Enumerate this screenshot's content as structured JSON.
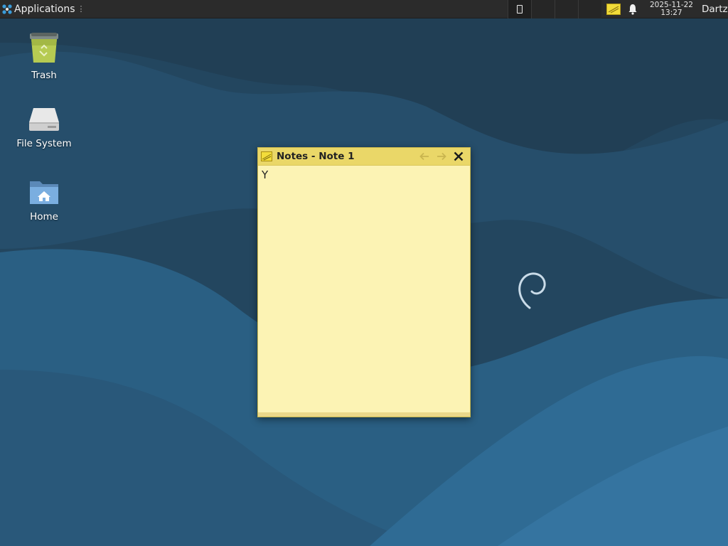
{
  "panel": {
    "apps_label": "Applications",
    "apps_grip": "⋮",
    "clock_date": "2025-11-22",
    "clock_time": "13:27",
    "user": "Dartz"
  },
  "desktop": {
    "icons": [
      {
        "label": "Trash",
        "icon": "trash-icon"
      },
      {
        "label": "File System",
        "icon": "drive-icon"
      },
      {
        "label": "Home",
        "icon": "home-folder-icon"
      }
    ]
  },
  "note": {
    "title": "Notes - Note 1",
    "content": "Y"
  },
  "colors": {
    "panel": "#2b2b2b",
    "wallpaper_dark": "#1f3f57",
    "wallpaper_mid": "#24506e",
    "wallpaper_light": "#2d6a90",
    "note_bg": "#fcf3b4",
    "note_titlebar": "#ead768"
  }
}
